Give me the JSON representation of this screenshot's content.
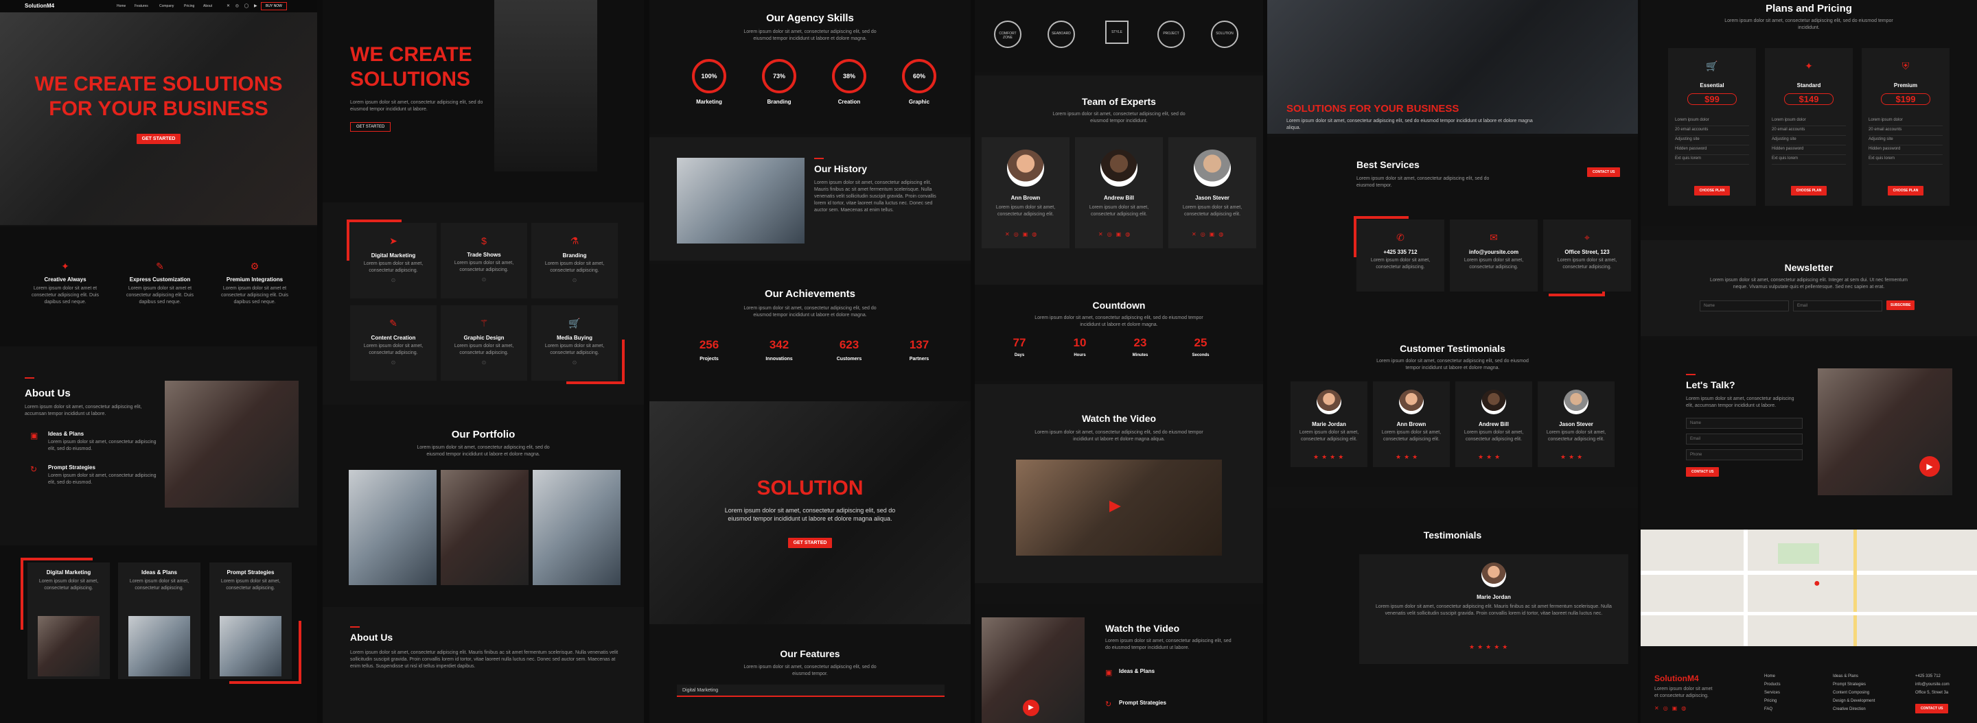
{
  "brand": {
    "name": "SolutionM4",
    "accent": "#e5231b"
  },
  "nav": {
    "items": [
      "Home",
      "Features",
      "Company",
      "Pricing",
      "About"
    ],
    "buy": "BUY NOW"
  },
  "col1": {
    "hero1": "WE CREATE SOLUTIONS",
    "hero2": "FOR YOUR BUSINESS",
    "cta": "GET STARTED",
    "features": [
      {
        "title": "Creative Always",
        "icon": "lightbulb-icon"
      },
      {
        "title": "Express Customization",
        "icon": "edit-icon"
      },
      {
        "title": "Premium Integrations",
        "icon": "gear-icon"
      }
    ],
    "feature_text": "Lorem ipsum dolor sit amet et consectetur adipiscing elit. Duis dapibus sed neque.",
    "about_title": "About Us",
    "about_text": "Lorem ipsum dolor sit amet, consectetur adipiscing elit, accumsan tempor incididunt ut labore.",
    "about_items": [
      {
        "title": "Ideas & Plans",
        "text": "Lorem ipsum dolor sit amet, consectetur adipiscing elit, sed do eiusmod."
      },
      {
        "title": "Prompt Strategies",
        "text": "Lorem ipsum dolor sit amet, consectetur adipiscing elit, sed do eiusmod."
      }
    ],
    "cards": [
      {
        "title": "Digital Marketing"
      },
      {
        "title": "Ideas & Plans"
      },
      {
        "title": "Prompt Strategies"
      }
    ],
    "card_text": "Lorem ipsum dolor sit amet, consectetur adipiscing."
  },
  "col2": {
    "hero1": "WE CREATE",
    "hero2": "SOLUTIONS",
    "text": "Lorem ipsum dolor sit amet, consectetur adipiscing elit, sed do eiusmod tempor incididunt ut labore.",
    "cta": "GET STARTED",
    "services": [
      {
        "title": "Digital Marketing",
        "icon": "send-icon"
      },
      {
        "title": "Trade Shows",
        "icon": "dollar-icon"
      },
      {
        "title": "Branding",
        "icon": "flask-icon"
      },
      {
        "title": "Content Creation",
        "icon": "edit-icon"
      },
      {
        "title": "Graphic Design",
        "icon": "wand-icon"
      },
      {
        "title": "Media Buying",
        "icon": "cart-icon"
      }
    ],
    "service_text": "Lorem ipsum dolor sit amet, consectetur adipiscing.",
    "portfolio_title": "Our Portfolio",
    "portfolio_text": "Lorem ipsum dolor sit amet, consectetur adipiscing elit, sed do eiusmod tempor incididunt ut labore et dolore magna.",
    "about_title": "About Us",
    "about_text": "Lorem ipsum dolor sit amet, consectetur adipiscing elit. Mauris finibus ac sit amet fermentum scelerisque. Nulla venenatis velit sollicitudin suscipit gravida. Proin convallis lorem id tortor, vitae laoreet nulla luctus nec. Donec sed auctor sem. Maecenas at enim tellus. Suspendisse ut nisl id tellus imperdiet dapibus."
  },
  "col3": {
    "skills_title": "Our Agency Skills",
    "skills_text": "Lorem ipsum dolor sit amet, consectetur adipiscing elit, sed do eiusmod tempor incididunt ut labore et dolore magna.",
    "skills": [
      {
        "value": "100%",
        "label": "Marketing"
      },
      {
        "value": "73%",
        "label": "Branding"
      },
      {
        "value": "38%",
        "label": "Creation"
      },
      {
        "value": "60%",
        "label": "Graphic"
      }
    ],
    "history_title": "Our History",
    "history_text": "Lorem ipsum dolor sit amet, consectetur adipiscing elit. Mauris finibus ac sit amet fermentum scelerisque. Nulla venenatis velit sollicitudin suscipit gravida. Proin convallis lorem id tortor, vitae laoreet nulla luctus nec. Donec sed auctor sem. Maecenas at enim tellus.",
    "ach_title": "Our Achievements",
    "ach_text": "Lorem ipsum dolor sit amet, consectetur adipiscing elit, sed do eiusmod tempor incididunt ut labore et dolore magna.",
    "ach": [
      {
        "value": "256",
        "label": "Projects"
      },
      {
        "value": "342",
        "label": "Innovations"
      },
      {
        "value": "623",
        "label": "Customers"
      },
      {
        "value": "137",
        "label": "Partners"
      }
    ],
    "solution": "SOLUTION",
    "solution_text": "Lorem ipsum dolor sit amet, consectetur adipiscing elit, sed do eiusmod tempor incididunt ut labore et dolore magna aliqua.",
    "cta": "GET STARTED",
    "features_title": "Our Features",
    "features_text": "Lorem ipsum dolor sit amet, consectetur adipiscing elit, sed do eiusmod tempor.",
    "features_tab": "Digital Marketing"
  },
  "col4": {
    "logos": [
      "COMFORT ZONE",
      "SEABOARD",
      "STYLE",
      "PROJECT",
      "SOLUTION"
    ],
    "team_title": "Team of Experts",
    "team_text": "Lorem ipsum dolor sit amet, consectetur adipiscing elit, sed do eiusmod tempor incididunt.",
    "team": [
      {
        "name": "Ann Brown"
      },
      {
        "name": "Andrew Bill"
      },
      {
        "name": "Jason Stever"
      }
    ],
    "team_member_text": "Lorem ipsum dolor sit amet, consectetur adipiscing elit.",
    "countdown_title": "Countdown",
    "countdown_text": "Lorem ipsum dolor sit amet, consectetur adipiscing elit, sed do eiusmod tempor incididunt ut labore et dolore magna.",
    "countdown": [
      {
        "value": "77",
        "label": "Days"
      },
      {
        "value": "10",
        "label": "Hours"
      },
      {
        "value": "23",
        "label": "Minutes"
      },
      {
        "value": "25",
        "label": "Seconds"
      }
    ],
    "video_title": "Watch the Video",
    "video_text": "Lorem ipsum dolor sit amet, consectetur adipiscing elit, sed do eiusmod tempor incididunt ut labore et dolore magna aliqua.",
    "video2_title": "Watch the Video",
    "video2_text": "Lorem ipsum dolor sit amet, consectetur adipiscing elit, sed do eiusmod tempor incididunt ut labore.",
    "video2_items": [
      {
        "title": "Ideas & Plans"
      },
      {
        "title": "Prompt Strategies"
      }
    ]
  },
  "col5": {
    "hero": "SOLUTIONS FOR YOUR BUSINESS",
    "hero_text": "Lorem ipsum dolor sit amet, consectetur adipiscing elit, sed do eiusmod tempor incididunt ut labore et dolore magna aliqua.",
    "services_title": "Best Services",
    "services_text": "Lorem ipsum dolor sit amet, consectetur adipiscing elit, sed do eiusmod tempor.",
    "contact": "CONTACT US",
    "contacts": [
      {
        "title": "+425 335 712",
        "icon": "phone-icon"
      },
      {
        "title": "info@yoursite.com",
        "icon": "mail-icon"
      },
      {
        "title": "Office Street, 123",
        "icon": "map-pin-icon"
      }
    ],
    "contact_text": "Lorem ipsum dolor sit amet, consectetur adipiscing.",
    "testi_title": "Customer Testimonials",
    "testi_text": "Lorem ipsum dolor sit amet, consectetur adipiscing elit, sed do eiusmod tempor incididunt ut labore et dolore magna.",
    "testi": [
      {
        "name": "Marie Jordan"
      },
      {
        "name": "Ann Brown"
      },
      {
        "name": "Andrew Bill"
      },
      {
        "name": "Jason Stever"
      }
    ],
    "testi_card_text": "Lorem ipsum dolor sit amet, consectetur adipiscing elit.",
    "testi2_title": "Testimonials",
    "testi2_name": "Marie Jordan",
    "testi2_text": "Lorem ipsum dolor sit amet, consectetur adipiscing elit. Mauris finibus ac sit amet fermentum scelerisque. Nulla venenatis velit sollicitudin suscipit gravida. Proin convallis lorem id tortor, vitae laoreet nulla luctus nec."
  },
  "col6": {
    "plans_title": "Plans and Pricing",
    "plans_text": "Lorem ipsum dolor sit amet, consectetur adipiscing elit, sed do eiusmod tempor incididunt.",
    "plans": [
      {
        "name": "Essential",
        "price": "$99",
        "icon": "cart-icon"
      },
      {
        "name": "Standard",
        "price": "$149",
        "icon": "lightbulb-icon"
      },
      {
        "name": "Premium",
        "price": "$199",
        "icon": "shield-icon"
      }
    ],
    "plan_rows": [
      "Lorem ipsum dolor",
      "20 email accounts",
      "Adjusting site",
      "Hidden password",
      "Ext quis lorem"
    ],
    "plan_cta": "CHOOSE PLAN",
    "news_title": "Newsletter",
    "news_text": "Lorem ipsum dolor sit amet, consectetur adipiscing elit. Integer at sem dui. Ut nec fermentum neque. Vivamus vulputate quis et pellentesque. Sed nec sapien at erat.",
    "news_name": "Name",
    "news_email": "Email",
    "news_cta": "SUBSCRIBE",
    "talk_title": "Let's Talk?",
    "talk_text": "Lorem ipsum dolor sit amet, consectetur adipiscing elit, accumsan tempor incididunt ut labore.",
    "talk_fields": [
      "Name",
      "Email",
      "Phone"
    ],
    "talk_cta": "CONTACT US",
    "footer_brand": "SolutionM4",
    "footer_text": "Lorem ipsum dolor sit amet et consectetur adipiscing.",
    "footer_links1": [
      "Home",
      "Products",
      "Services",
      "Pricing",
      "FAQ"
    ],
    "footer_links2": [
      "Ideas & Plans",
      "Prompt Strategies",
      "Content Composing",
      "Design & Development",
      "Creative Direction"
    ],
    "footer_contact": [
      "+425 335 712",
      "info@yoursite.com",
      "Office 5, Street 3a"
    ],
    "footer_cta": "CONTACT US"
  }
}
